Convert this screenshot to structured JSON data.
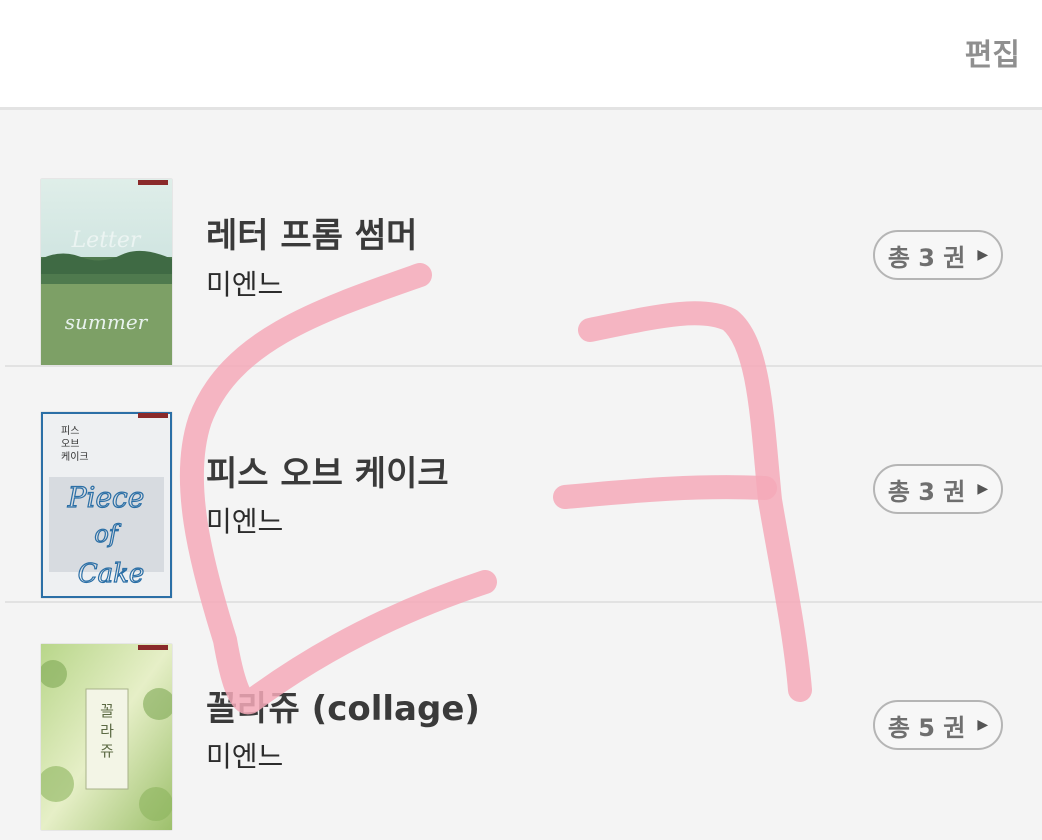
{
  "header": {
    "edit_label": "편집"
  },
  "books": [
    {
      "title": "레터 프롬 썸머",
      "author": "미엔느",
      "count_label": "총 3 권",
      "cover_text": "레터 프롬 썸머"
    },
    {
      "title": "피스 오브 케이크",
      "author": "미엔느",
      "count_label": "총 3 권",
      "cover_text": "피스 오브 케이크"
    },
    {
      "title": "꼴라쥬 (collage)",
      "author": "미엔느",
      "count_label": "총 5 권",
      "cover_text": "꼴라쥬"
    }
  ],
  "colors": {
    "scribble": "#f4a9b9",
    "badge_border": "#b5b5b5",
    "edit_text": "#8f8f8f"
  },
  "icons": {
    "badge_arrow": "triangle-right-icon"
  }
}
